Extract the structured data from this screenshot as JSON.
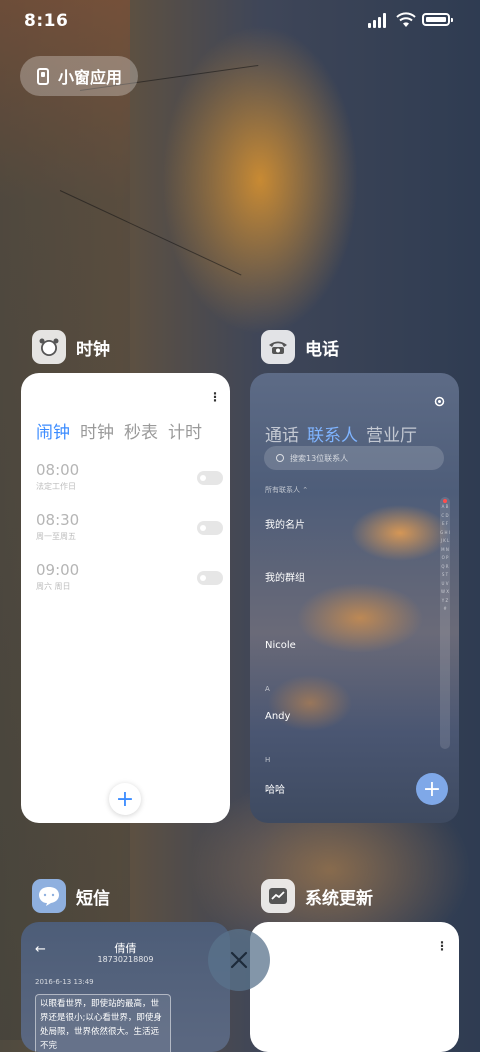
{
  "status_bar": {
    "time": "8:16"
  },
  "mini_window": {
    "label": "小窗应用"
  },
  "apps": {
    "clock": {
      "title": "时钟",
      "tabs": [
        "闹钟",
        "时钟",
        "秒表",
        "计时"
      ],
      "active_tab": 0,
      "alarms": [
        {
          "time": "08:00",
          "desc": "法定工作日"
        },
        {
          "time": "08:30",
          "desc": "周一至周五"
        },
        {
          "time": "09:00",
          "desc": "周六 周日"
        }
      ],
      "add_label": "+"
    },
    "phone": {
      "title": "电话",
      "tabs": [
        "通话",
        "联系人",
        "营业厅"
      ],
      "active_tab": 1,
      "search_placeholder": "搜索13位联系人",
      "filter_label": "所有联系人",
      "my_card": "我的名片",
      "my_groups": "我的群组",
      "section_letters": [
        "A",
        "H"
      ],
      "contacts": [
        "Nicole",
        "Andy",
        "哈哈"
      ],
      "index_letters": "A B C D E F G H I J K L M N O P Q R S T U V W X Y Z #",
      "add_label": "+"
    },
    "sms": {
      "title": "短信",
      "contact_name": "倩倩",
      "contact_number": "18730218809",
      "date": "2016-6-13 13:49",
      "message": "以眼看世界，即使站的最高，世界还是很小;以心看世界，即使身处局限，世界依然很大。生活远不完"
    },
    "system_update": {
      "title": "系统更新"
    }
  },
  "colors": {
    "accent": "#3c8cff",
    "phone_accent": "#7fb4ff"
  }
}
